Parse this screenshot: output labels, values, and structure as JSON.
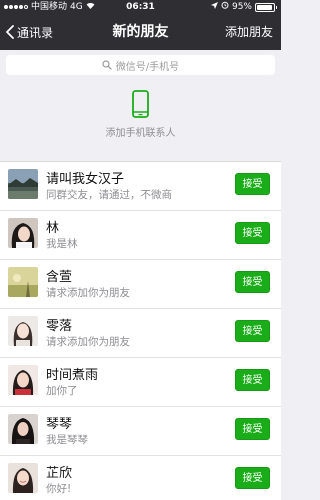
{
  "status_bar": {
    "carrier": "中国移动",
    "network": "4G",
    "time": "06:31",
    "battery": "95%",
    "battery_level": 0.95,
    "icons": [
      "signal-dots-icon",
      "wifi-icon",
      "location-arrow-icon",
      "alarm-icon",
      "battery-icon"
    ]
  },
  "nav": {
    "back_label": "通讯录",
    "title": "新的朋友",
    "right_label": "添加朋友"
  },
  "search": {
    "placeholder": "微信号/手机号"
  },
  "add_phone": {
    "label": "添加手机联系人",
    "icon": "phone-icon",
    "icon_color": "#1aad19"
  },
  "friends": [
    {
      "name": "请叫我女汉子",
      "message": "同群交友，请通过，不微商",
      "action": "接受",
      "avatar": "avatar-landscape"
    },
    {
      "name": "林",
      "message": "我是林",
      "action": "接受",
      "avatar": "avatar-girl-dark-hair"
    },
    {
      "name": "含萱",
      "message": "请求添加你为朋友",
      "action": "接受",
      "avatar": "avatar-yellow-field"
    },
    {
      "name": "零落",
      "message": "请求添加你为朋友",
      "action": "接受",
      "avatar": "avatar-girl-light"
    },
    {
      "name": "时间煮雨",
      "message": "加你了",
      "action": "接受",
      "avatar": "avatar-girl-red"
    },
    {
      "name": "琴琴",
      "message": "我是琴琴",
      "action": "接受",
      "avatar": "avatar-girl-dark"
    },
    {
      "name": "芷欣",
      "message": "你好!",
      "action": "接受",
      "avatar": "avatar-girl-smile"
    }
  ],
  "colors": {
    "nav_background": "#2e2e33",
    "accept_button": "#1aad19",
    "page_background": "#efeff4"
  }
}
